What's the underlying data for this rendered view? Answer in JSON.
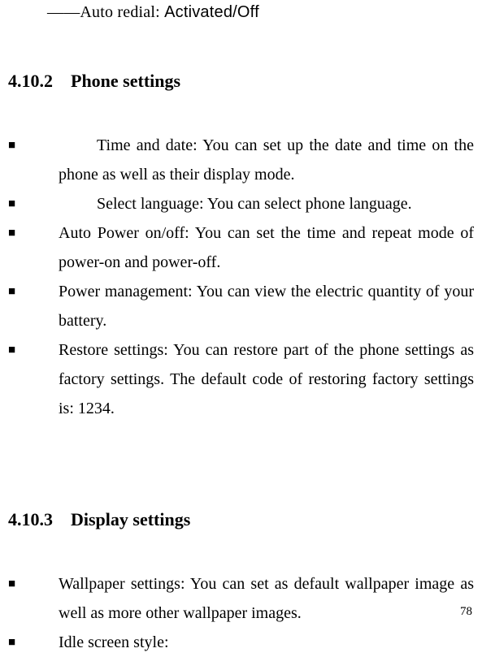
{
  "auto_redial": {
    "dashes": "――",
    "label": "Auto redial: ",
    "value": "Activated/Off"
  },
  "section_4_10_2": {
    "number": "4.10.2",
    "title": "Phone settings",
    "items": [
      {
        "text": "Time and date: You can set up the date and time on the phone as well as their display mode.",
        "extra_indent": true
      },
      {
        "text": "Select language: You can select phone language.",
        "extra_indent": true
      },
      {
        "text": "Auto Power on/off: You can set the time and repeat mode of power-on and power-off.",
        "extra_indent": false
      },
      {
        "text": "Power management: You can view the electric quantity of your battery.",
        "extra_indent": false
      },
      {
        "text": "Restore settings: You can restore part of the phone settings as factory settings. The default code of restoring factory settings is: 1234.",
        "extra_indent": false
      }
    ]
  },
  "section_4_10_3": {
    "number": "4.10.3",
    "title": "Display settings",
    "items": [
      {
        "text": "Wallpaper settings: You can set as default wallpaper image as well as more other wallpaper images.",
        "extra_indent": false
      },
      {
        "text": "Idle screen style:",
        "extra_indent": false
      }
    ]
  },
  "page_number": "78"
}
